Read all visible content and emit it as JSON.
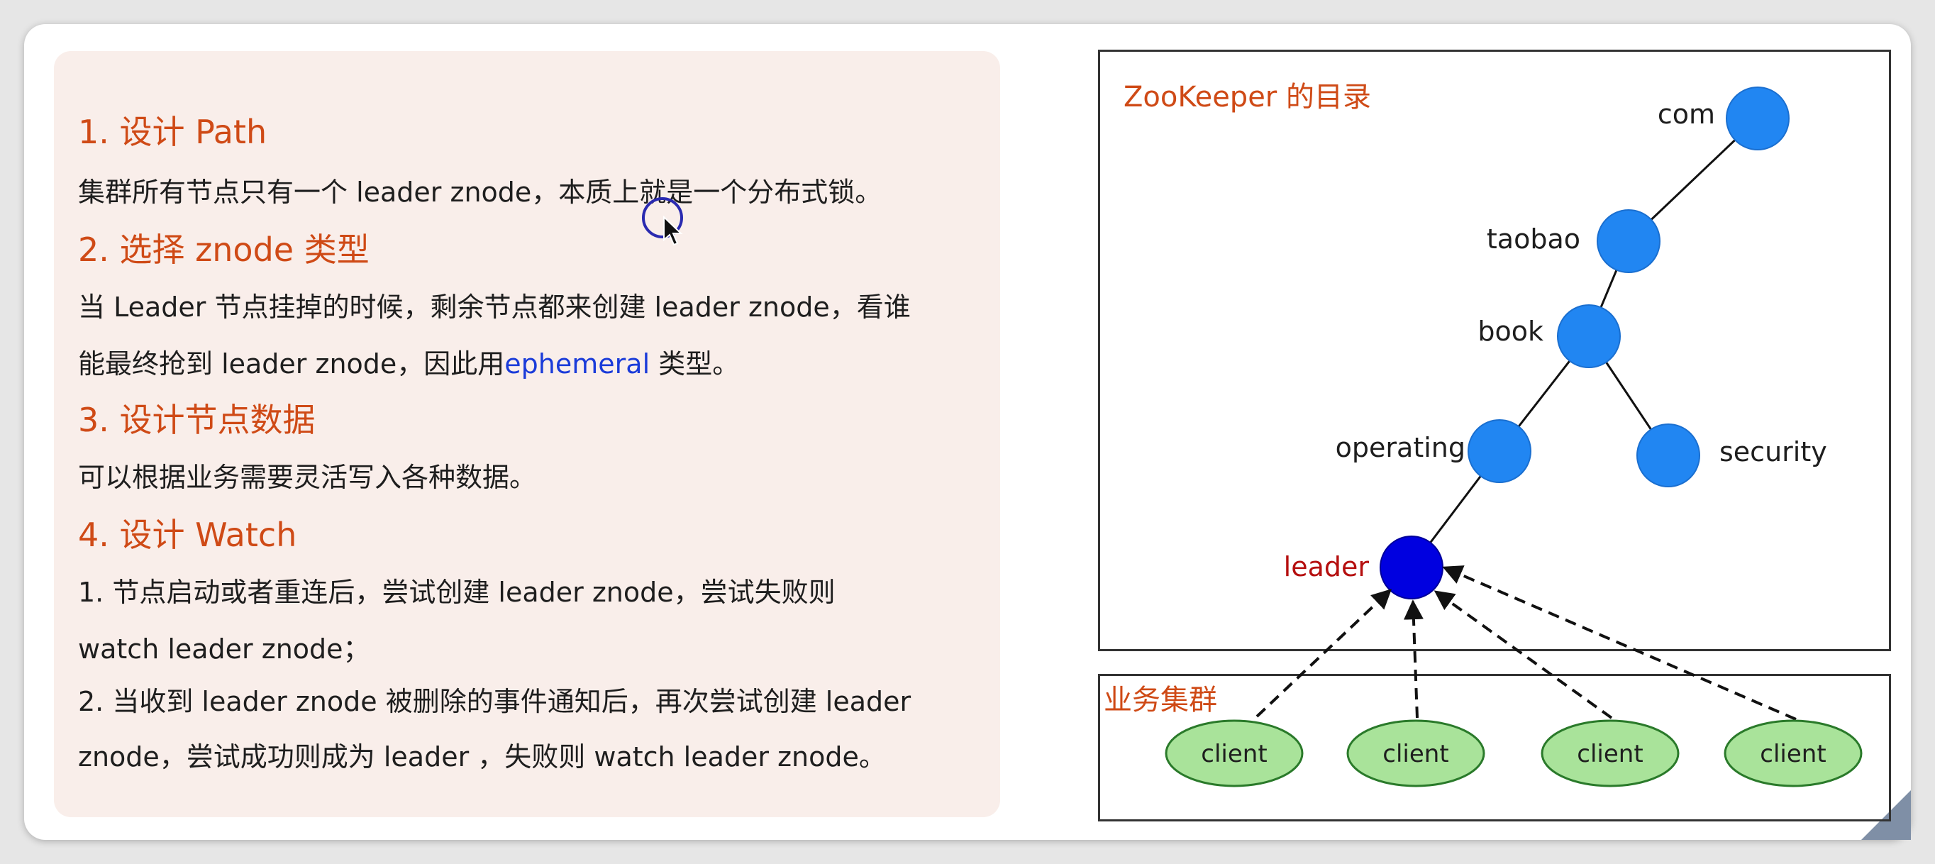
{
  "notes": {
    "h1": "1. 设计 Path",
    "p1": "集群所有节点只有一个 leader znode，本质上就是一个分布式锁。",
    "h2": "2. 选择 znode 类型",
    "p2_line1": "当 Leader 节点挂掉的时候，剩余节点都来创建 leader znode，看谁",
    "p2_line2_a": "能最终抢到 leader znode，因此用",
    "p2_line2_b": "ephemeral",
    "p2_line2_c": " 类型。",
    "h3": "3. 设计节点数据",
    "p3": "可以根据业务需要灵活写入各种数据。",
    "h4": "4. 设计 Watch",
    "p4_line1": "1. 节点启动或者重连后，尝试创建 leader znode，尝试失败则",
    "p4_line2": "watch leader znode；",
    "p4_line3": "2. 当收到 leader znode 被删除的事件通知后，再次尝试创建 leader",
    "p4_line4": "znode，尝试成功则成为 leader ，失败则 watch leader znode。"
  },
  "diagram": {
    "tree_title": "ZooKeeper 的目录",
    "cluster_title": "业务集群",
    "nodes": {
      "com": "com",
      "taobao": "taobao",
      "book": "book",
      "operating": "operating",
      "security": "security",
      "leader": "leader"
    },
    "clients": [
      "client",
      "client",
      "client",
      "client"
    ]
  },
  "colors": {
    "heading": "#cf4a16",
    "node": "#2186f2",
    "leader_node": "#0000e0",
    "leader_label": "#b50f0f",
    "client_fill": "#a9e39a",
    "client_stroke": "#2a7a2a",
    "panel_bg": "#f9eeea",
    "highlight_text": "#1a3bd9"
  }
}
